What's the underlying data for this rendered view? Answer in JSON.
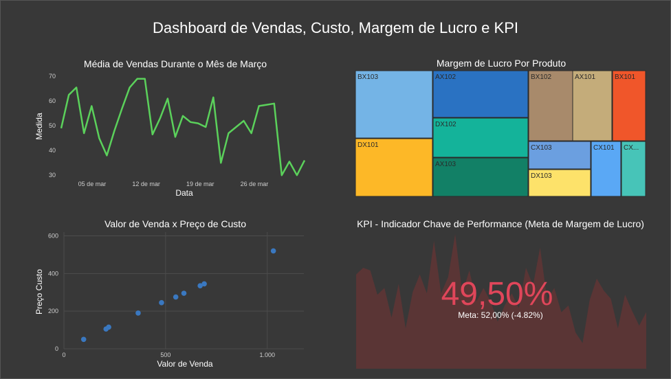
{
  "title": "Dashboard de Vendas, Custo, Margem de Lucro e KPI",
  "colors": {
    "background": "#383838",
    "line": "#5bd15b",
    "scatter": "#3a78c0",
    "kpi_value": "#e0465a",
    "kpi_area": "#5a3535",
    "text": "#ffffff",
    "tick": "#cfcfcf"
  },
  "chart_data": [
    {
      "type": "line",
      "title": "Média de Vendas Durante o Mês de Março",
      "xlabel": "Data",
      "ylabel": "Medida",
      "x": [
        1,
        2,
        3,
        4,
        5,
        6,
        7,
        8,
        9,
        10,
        11,
        12,
        13,
        14,
        15,
        16,
        17,
        18,
        19,
        20,
        21,
        22,
        23,
        24,
        25,
        26,
        27,
        28,
        29,
        30,
        31
      ],
      "y": [
        49,
        62.5,
        65.5,
        47,
        58,
        45,
        38,
        48,
        57,
        65.5,
        69,
        69,
        46.5,
        53,
        61,
        45.5,
        54,
        51.5,
        51,
        49.5,
        61.5,
        35,
        47,
        49.5,
        52,
        47,
        58,
        58.5,
        59,
        30,
        35.5,
        30,
        36
      ],
      "x_ticks": [
        {
          "v": 5,
          "label": "05 de mar"
        },
        {
          "v": 12,
          "label": "12 de mar"
        },
        {
          "v": 19,
          "label": "19 de mar"
        },
        {
          "v": 26,
          "label": "26 de mar"
        }
      ],
      "y_ticks": [
        30,
        40,
        50,
        60,
        70
      ],
      "xlim": [
        1,
        32.5
      ],
      "ylim": [
        27,
        72
      ],
      "grid": false
    },
    {
      "type": "treemap",
      "title": "Margem de Lucro Por Produto",
      "items": [
        {
          "label": "BX103",
          "color": "#74b4e6"
        },
        {
          "label": "DX101",
          "color": "#fdb827"
        },
        {
          "label": "AX102",
          "color": "#2a72c2"
        },
        {
          "label": "DX102",
          "color": "#14b39a"
        },
        {
          "label": "AX103",
          "color": "#128066"
        },
        {
          "label": "BX102",
          "color": "#a88a6b"
        },
        {
          "label": "AX101",
          "color": "#c4ac7a"
        },
        {
          "label": "BX101",
          "color": "#f0562a"
        },
        {
          "label": "CX103",
          "color": "#6b9fe0"
        },
        {
          "label": "DX103",
          "color": "#fde26a"
        },
        {
          "label": "CX101",
          "color": "#5aa8f5"
        },
        {
          "label": "CX...",
          "color": "#47c4b8"
        }
      ]
    },
    {
      "type": "scatter",
      "title": "Valor de Venda x Preço de Custo",
      "xlabel": "Valor de Venda",
      "ylabel": "Preço Custo",
      "points": [
        [
          97,
          50
        ],
        [
          207,
          105
        ],
        [
          220,
          115
        ],
        [
          365,
          190
        ],
        [
          480,
          245
        ],
        [
          550,
          275
        ],
        [
          590,
          295
        ],
        [
          670,
          335
        ],
        [
          690,
          345
        ],
        [
          1030,
          520
        ]
      ],
      "x_ticks": [
        {
          "v": 0,
          "label": "0"
        },
        {
          "v": 500,
          "label": "500"
        },
        {
          "v": 1000,
          "label": "1.000"
        }
      ],
      "y_ticks": [
        {
          "v": 0,
          "label": "0"
        },
        {
          "v": 200,
          "label": "200"
        },
        {
          "v": 400,
          "label": "400"
        },
        {
          "v": 600,
          "label": "600"
        }
      ],
      "xlim": [
        0,
        1180
      ],
      "ylim": [
        0,
        620
      ],
      "grid": true
    },
    {
      "type": "kpi",
      "title": "KPI - Indicador Chave de Performance (Meta de Margem de Lucro)",
      "value": "49,50%",
      "reference": "Meta: 52,00% (-4.82%)",
      "sparkline": [
        0.7,
        0.75,
        0.73,
        0.55,
        0.6,
        0.38,
        0.63,
        0.3,
        0.57,
        0.7,
        0.56,
        0.95,
        0.56,
        0.68,
        1.0,
        0.56,
        0.73,
        0.5,
        0.6,
        0.5,
        0.35,
        0.47,
        0.56,
        0.45,
        0.75,
        0.62,
        0.9,
        0.51,
        0.6,
        0.42,
        0.47,
        0.27,
        0.19,
        0.51,
        0.67,
        0.58,
        0.52,
        0.3,
        0.55,
        0.43,
        0.32,
        0.42
      ]
    }
  ]
}
